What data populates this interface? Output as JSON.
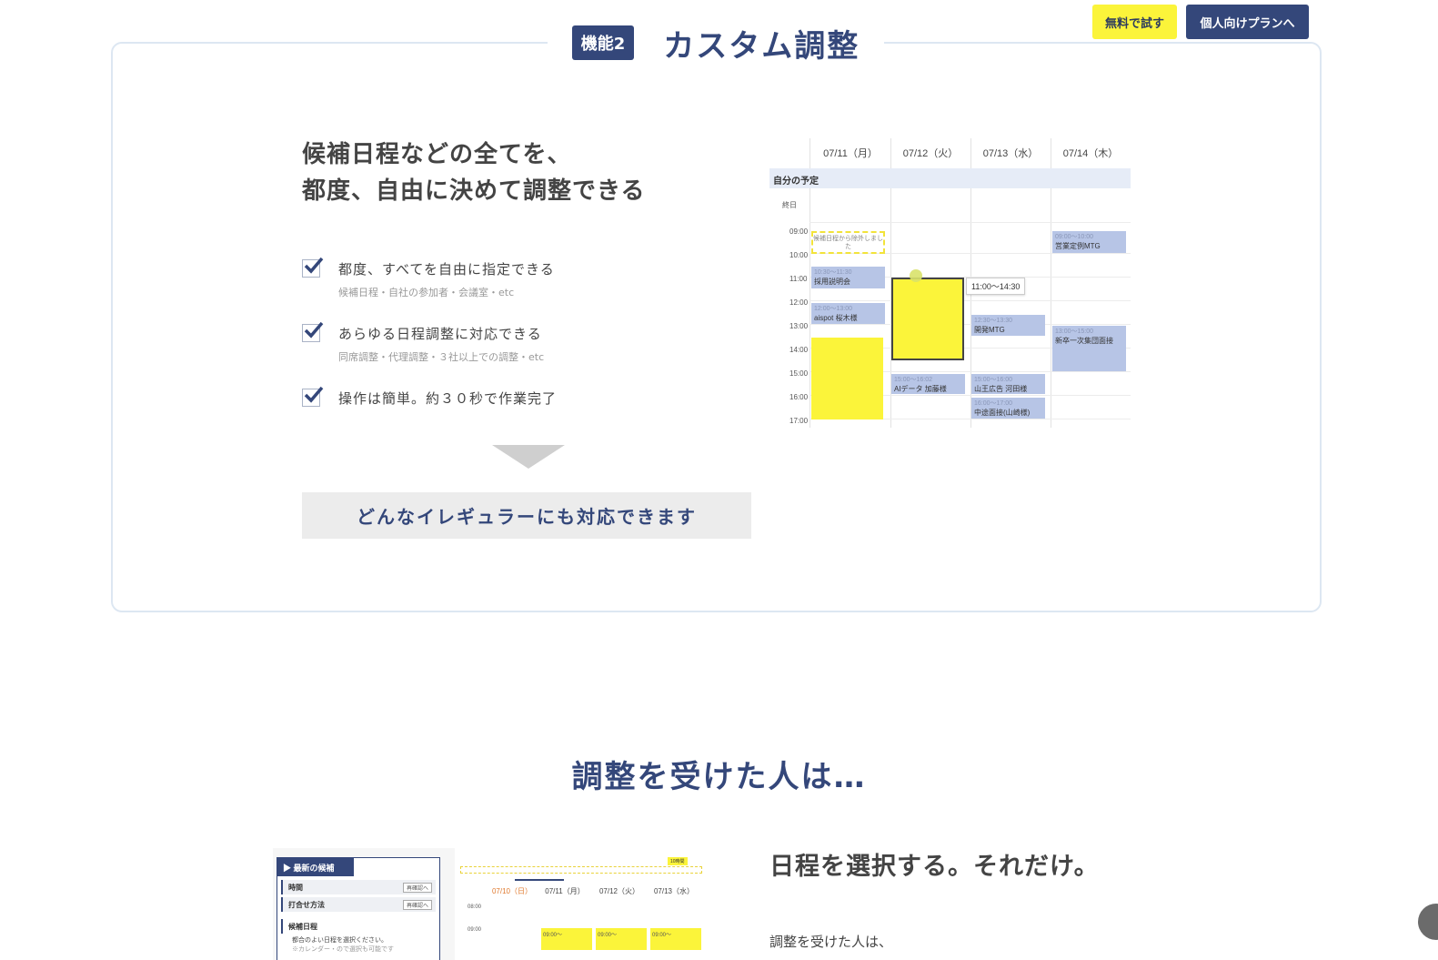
{
  "header": {
    "try_free": "無料で試す",
    "personal_plan": "個人向けプランへ"
  },
  "feature": {
    "badge": "機能2",
    "title": "カスタム調整",
    "lead_line1": "候補日程などの全てを、",
    "lead_line2": "都度、自由に決めて調整できる",
    "items": [
      {
        "title": "都度、すべてを自由に指定できる",
        "sub": "候補日程・自社の参加者・会議室・etc"
      },
      {
        "title": "あらゆる日程調整に対応できる",
        "sub": "同席調整・代理調整・３社以上での調整・etc"
      },
      {
        "title": "操作は簡単。約３０秒で作業完了",
        "sub": ""
      }
    ],
    "cta": "どんなイレギュラーにも対応できます"
  },
  "calendar": {
    "days": [
      "07/11（月）",
      "07/12（火）",
      "07/13（水）",
      "07/14（木）"
    ],
    "my_schedule": "自分の予定",
    "all_day": "終日",
    "times": [
      "09:00",
      "10:00",
      "11:00",
      "12:00",
      "13:00",
      "14:00",
      "15:00",
      "16:00",
      "17:00"
    ],
    "excluded_note": "候補日程から除外しました",
    "selection_tooltip": "11:00〜14:30",
    "events": [
      {
        "time": "10:30〜11:30",
        "title": "採用説明会"
      },
      {
        "time": "12:00〜13:00",
        "title": "aispot 桜木様"
      },
      {
        "time": "15:00〜16:02",
        "title": "AIデータ 加藤様"
      },
      {
        "time": "12:30〜13:30",
        "title": "開発MTG"
      },
      {
        "time": "15:00〜16:00",
        "title": "山王広告 河田様"
      },
      {
        "time": "16:00〜17:00",
        "title": "中途面接(山崎様)"
      },
      {
        "time": "09:00〜10:00",
        "title": "営業定例MTG"
      },
      {
        "time": "13:00〜15:00",
        "title": "新卒一次集団面接"
      }
    ],
    "colors": {
      "event": "#b7c5e6",
      "candidate": "#fbf43a",
      "accent": "#34477a"
    }
  },
  "section2": {
    "title": "調整を受けた人は…",
    "lead": "日程を選択する。それだけ。",
    "body": "調整を受けた人は、",
    "mock": {
      "panel_title": "▶ 最新の候補",
      "row_time": "時間",
      "row_method": "打合せ方法",
      "row_tag": "再確認へ",
      "candidate_label": "候補日程",
      "instruction": "都合のよい日程を選択ください。",
      "note": "※カレンダー・ので選択も可能です",
      "days": [
        "07/10（日）",
        "07/11（月）",
        "07/12（火）",
        "07/13（水）"
      ],
      "times": [
        "08:00",
        "09:00"
      ],
      "slot": "09:00〜",
      "ruler_badge": "10時間"
    }
  }
}
